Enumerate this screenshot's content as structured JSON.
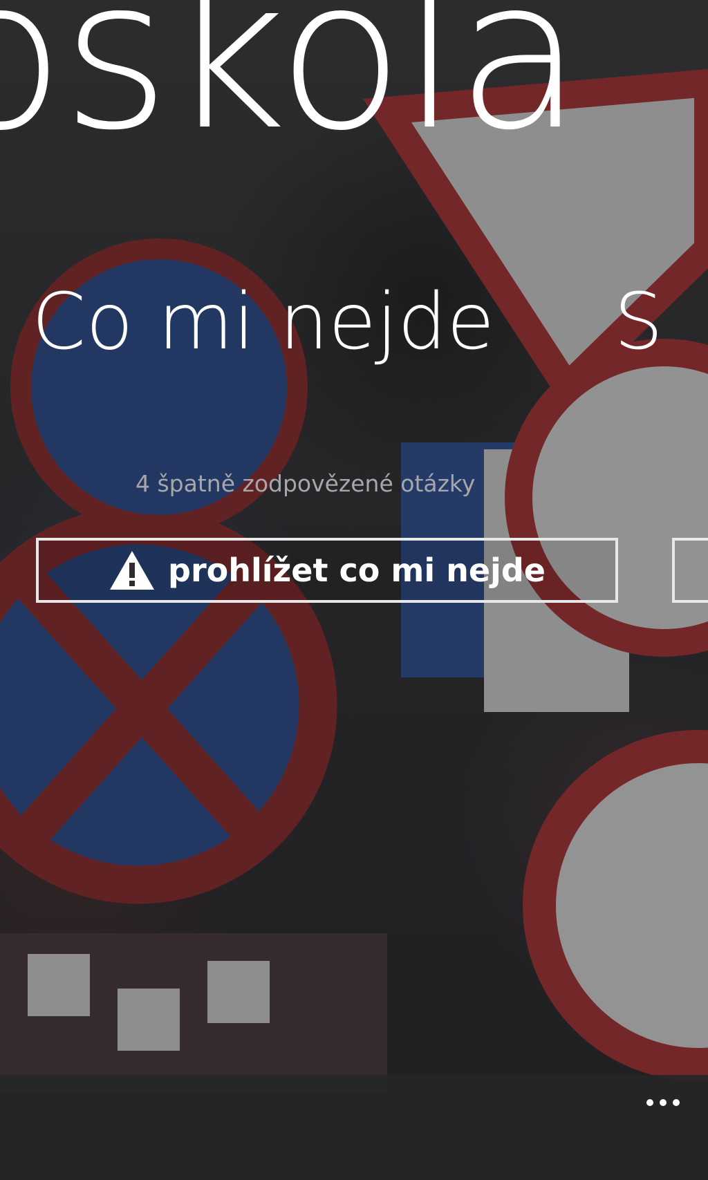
{
  "app": {
    "title": "oškola"
  },
  "pivot": {
    "current_header": "Co mi nejde",
    "next_header": "S"
  },
  "section": {
    "subtitle": "4 špatně zodpovězené otázky",
    "action_label": "prohlížet co mi nejde",
    "action_icon": "warning-icon"
  },
  "app_bar": {
    "more_icon": "more-icon"
  },
  "colors": {
    "text": "#ffffff",
    "subtle_text": "#a7a7ab",
    "button_border": "#e8e8e8",
    "app_bar": "#262628"
  }
}
